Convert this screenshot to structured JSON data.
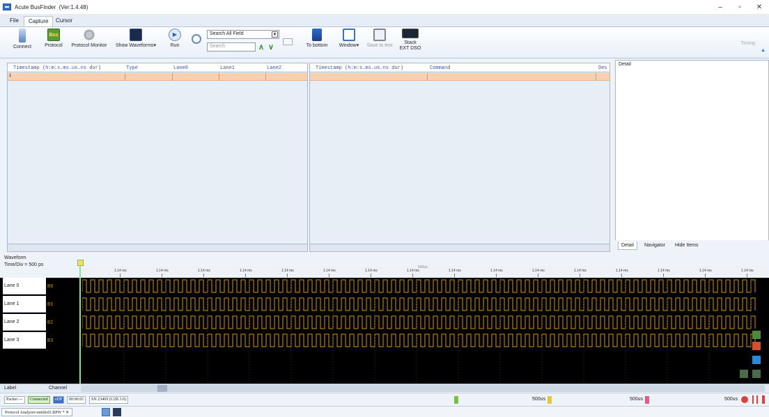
{
  "window": {
    "title": "Acute BusFinder",
    "version": "(Ver:1.4.48)",
    "min_icon": "minimize-icon",
    "restore_icon": "restore-icon",
    "close_icon": "close-icon"
  },
  "menu": {
    "tabs": [
      "File",
      "Capture",
      "Cursor"
    ],
    "active": "Capture"
  },
  "ribbon": {
    "connect": "Connect",
    "protocol": "Protocol",
    "protocol_monitor": "Protocol Monitor",
    "show_waveforms": "Show Waveforms",
    "run": "Run",
    "search_field": "Search All Field",
    "search_placeholder": "Search",
    "to_bottom": "To bottom",
    "window": "Window",
    "save_to_text": "Save to text",
    "stack_line1": "Stack",
    "stack_line2": "EXT DSO",
    "timing": "Timing"
  },
  "left_grid": {
    "headers": [
      "Timestamp (h:m:s.ms.us.ns dur)",
      "Type",
      "Lane0",
      "Lane1",
      "Lane2"
    ],
    "row_marker": "1"
  },
  "mid_grid": {
    "headers": [
      "Timestamp (h:m:s.ms.us.ns dur)",
      "Command",
      "Des"
    ]
  },
  "detail": {
    "title": "Detail",
    "tabs": [
      "Detail",
      "Navigator",
      "Hide Items"
    ]
  },
  "waveform": {
    "title": "Waveform",
    "time_div": "Time/Div = 500 ps",
    "tick_label": "1.14 ms",
    "center_label": "500us",
    "lanes": [
      {
        "label": "Lane 0",
        "channel": "B0"
      },
      {
        "label": "Lane 1",
        "channel": "B1"
      },
      {
        "label": "Lane 2",
        "channel": "B2"
      },
      {
        "label": "Lane 3",
        "channel": "B3"
      }
    ],
    "footer_label": "Label",
    "footer_channel": "Channel",
    "signal_color": "#d89a00"
  },
  "status": {
    "packet": "Packet ---",
    "connected": "Connected",
    "edp": "eDP",
    "time": "00:00:01",
    "sn": "SN 23469 (U2B 3.0)",
    "timing1": "500us",
    "timing2": "500us",
    "timing3": "500us"
  },
  "taskbar": {
    "doc": "Protocol Analyzer-untitled1.BPW *"
  }
}
